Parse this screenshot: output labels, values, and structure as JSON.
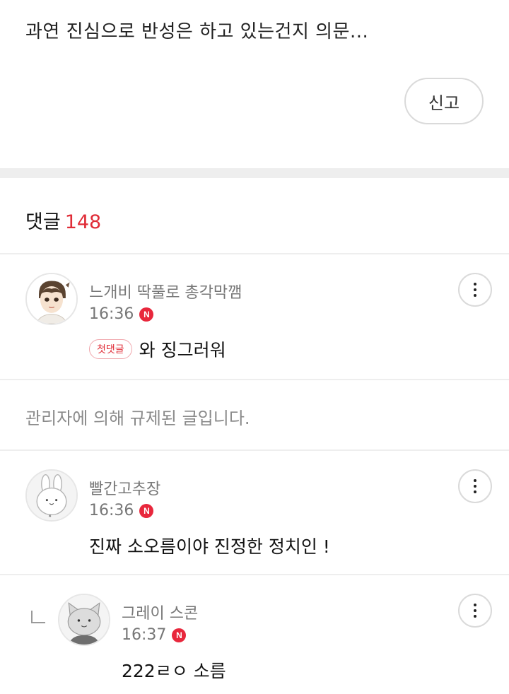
{
  "post": {
    "text": "과연 진심으로 반성은 하고 있는건지 의문...",
    "report_label": "신고"
  },
  "comments_section": {
    "label": "댓글",
    "count": "148"
  },
  "comments": [
    {
      "nickname": "느개비 딱풀로 총각막깸",
      "time": "16:36",
      "badge": "N",
      "first_badge": "첫댓글",
      "text": "와 징그러워"
    },
    {
      "nickname": "빨간고추장",
      "time": "16:36",
      "badge": "N",
      "text": "진짜 소오름이야 진정한 정치인 !"
    },
    {
      "nickname": "그레이 스콘",
      "time": "16:37",
      "badge": "N",
      "text": "222ㄹㅇ 소름"
    }
  ],
  "moderated_text": "관리자에 의해 규제된 글입니다.",
  "colors": {
    "accent_red": "#e02c37",
    "badge_red": "#e8273c",
    "divider": "#eeeeee",
    "muted_text": "#777777"
  },
  "icons": {
    "more": "more-vertical-icon",
    "reply": "reply-arrow-icon",
    "new": "new-badge-icon"
  }
}
